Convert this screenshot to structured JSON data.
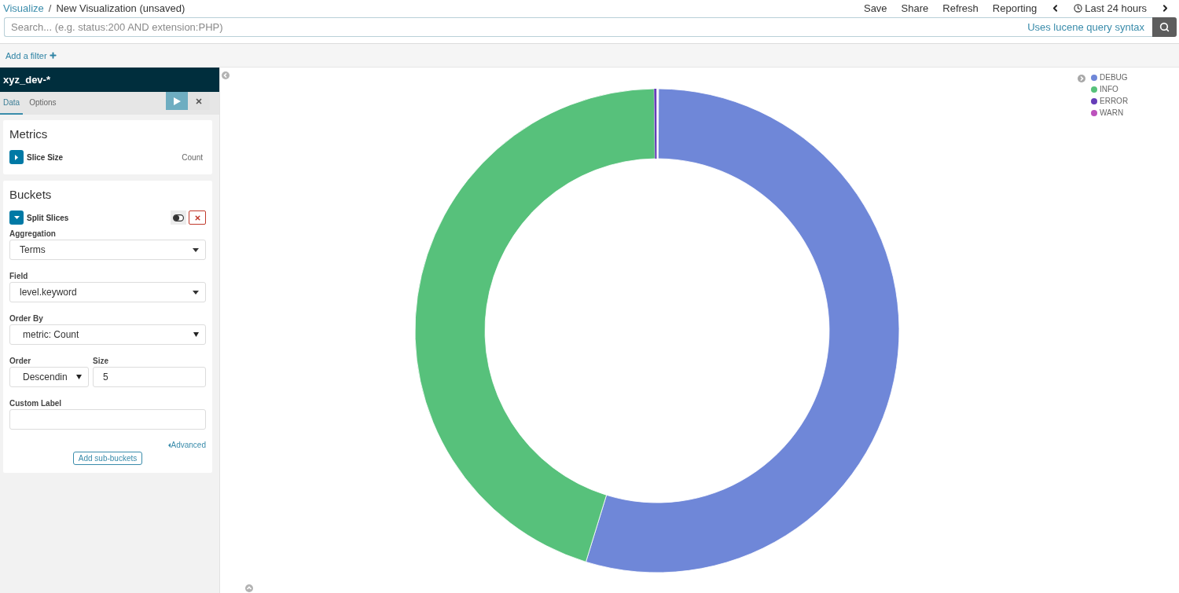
{
  "breadcrumb": {
    "parent": "Visualize",
    "separator": "/",
    "current": "New Visualization (unsaved)"
  },
  "top_nav": {
    "items": [
      "Save",
      "Share",
      "Refresh",
      "Reporting"
    ],
    "time_range": "Last 24 hours"
  },
  "search": {
    "placeholder": "Search... (e.g. status:200 AND extension:PHP)",
    "syntax_link": "Uses lucene query syntax"
  },
  "filter_bar": {
    "add_filter": "Add a filter"
  },
  "sidebar": {
    "index_pattern": "xyz_dev-*",
    "tabs": [
      {
        "label": "Data",
        "selected": true
      },
      {
        "label": "Options",
        "selected": false
      }
    ],
    "metrics": {
      "title": "Metrics",
      "items": [
        {
          "label": "Slice Size",
          "value": "Count",
          "expanded": false
        }
      ]
    },
    "buckets": {
      "title": "Buckets",
      "items": [
        {
          "label": "Split Slices",
          "expanded": true,
          "fields": [
            {
              "kind": "dropdown",
              "label": "Aggregation",
              "value": "Terms"
            },
            {
              "kind": "dropdown",
              "label": "Field",
              "value": "level.keyword"
            },
            {
              "kind": "native_select",
              "label": "Order By",
              "value": "metric: Count"
            }
          ],
          "order": {
            "label": "Order",
            "value": "Descendin"
          },
          "size": {
            "label": "Size",
            "value": "5"
          },
          "custom_label": {
            "label": "Custom Label"
          },
          "advanced_link": "Advanced"
        }
      ],
      "add_button": "Add sub-buckets"
    }
  },
  "chart": {
    "legend": [
      {
        "label": "DEBUG",
        "color": "#6f87d8"
      },
      {
        "label": "INFO",
        "color": "#57c17b"
      },
      {
        "label": "ERROR",
        "color": "#663db8"
      },
      {
        "label": "WARN",
        "color": "#bc52bc"
      }
    ]
  }
}
